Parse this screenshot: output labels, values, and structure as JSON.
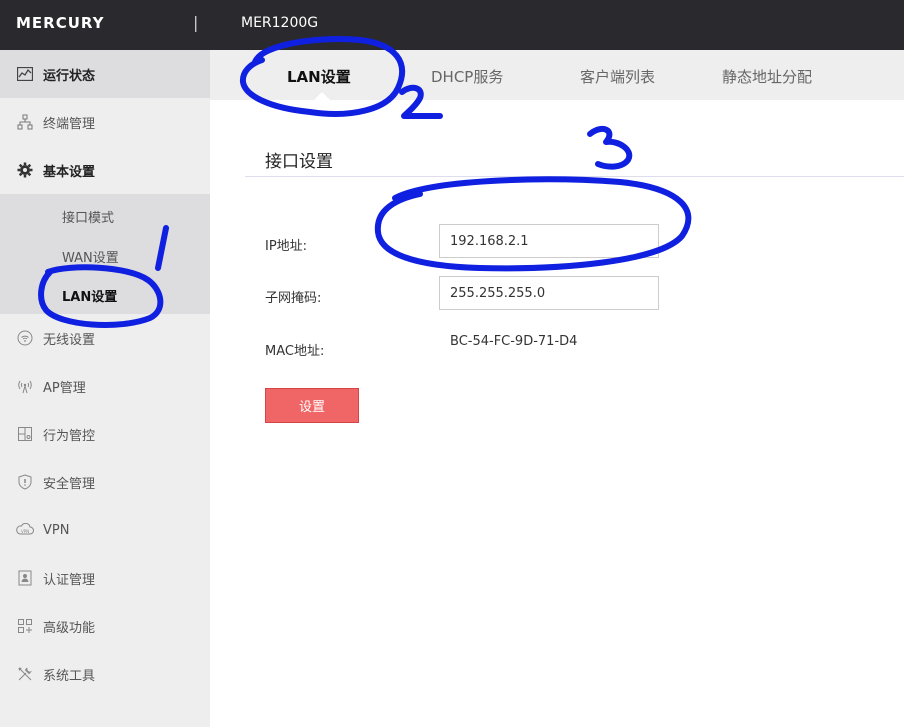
{
  "header": {
    "brand": "MERCURY",
    "separator": "|",
    "model": "MER1200G"
  },
  "sidebar": {
    "items": [
      {
        "label": "运行状态",
        "icon": "status-icon"
      },
      {
        "label": "终端管理",
        "icon": "network-icon"
      },
      {
        "label": "基本设置",
        "icon": "gear-icon"
      },
      {
        "label": "无线设置",
        "icon": "wifi-icon"
      },
      {
        "label": "AP管理",
        "icon": "ap-icon"
      },
      {
        "label": "行为管控",
        "icon": "behavior-icon"
      },
      {
        "label": "安全管理",
        "icon": "shield-icon"
      },
      {
        "label": "VPN",
        "icon": "vpn-icon"
      },
      {
        "label": "认证管理",
        "icon": "auth-icon"
      },
      {
        "label": "高级功能",
        "icon": "advanced-icon"
      },
      {
        "label": "系统工具",
        "icon": "tools-icon"
      }
    ],
    "submenu": [
      {
        "label": "接口模式"
      },
      {
        "label": "WAN设置"
      },
      {
        "label": "LAN设置"
      }
    ]
  },
  "tabs": [
    {
      "label": "LAN设置"
    },
    {
      "label": "DHCP服务"
    },
    {
      "label": "客户端列表"
    },
    {
      "label": "静态地址分配"
    }
  ],
  "form": {
    "section_title": "接口设置",
    "ip_label": "IP地址:",
    "ip_value": "192.168.2.1",
    "mask_label": "子网掩码:",
    "mask_value": "255.255.255.0",
    "mac_label": "MAC地址:",
    "mac_value": "BC-54-FC-9D-71-D4",
    "submit_label": "设置"
  },
  "colors": {
    "topbar": "#2a2a2e",
    "sidebar": "#eeeeef",
    "active": "#dddddf",
    "button": "#f06565",
    "annotation": "#1020e0"
  }
}
